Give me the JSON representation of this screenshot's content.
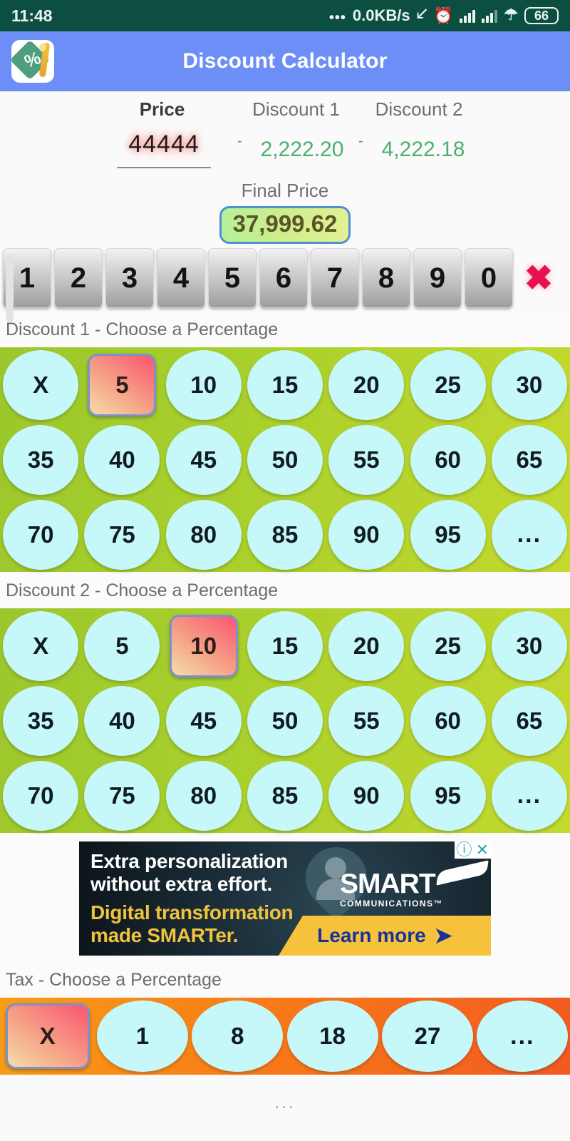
{
  "statusbar": {
    "time": "11:48",
    "dots": "•••",
    "net_speed": "0.0KB/s",
    "bluetooth_icon": "bluetooth-icon",
    "alarm_icon": "alarm-icon",
    "signal1_icon": "signal-bars-icon",
    "signal2_icon": "signal-bars-icon",
    "wifi_icon": "wifi-icon",
    "battery_level": "66",
    "bg_color": "#0c4f41"
  },
  "appbar": {
    "title": "Discount Calculator",
    "icon_name": "discount-tag-app-icon",
    "bg_color": "#6d8ef6"
  },
  "summary": {
    "price_label": "Price",
    "discount1_label": "Discount 1",
    "discount2_label": "Discount 2",
    "price_value": "44444",
    "minus1": "-",
    "minus2": "-",
    "discount1_value": "2,222.20",
    "discount2_value": "4,222.18",
    "final_label": "Final Price",
    "final_value": "37,999.62",
    "discount_color": "#4caf6d",
    "final_border_color": "#4d90d6"
  },
  "keypad": {
    "keys": [
      "1",
      "2",
      "3",
      "4",
      "5",
      "6",
      "7",
      "8",
      "9",
      "0"
    ],
    "delete_label": "✖",
    "delete_color": "#e8114e"
  },
  "discount1": {
    "label": "Discount 1 - Choose a Percentage",
    "options": [
      "X",
      "5",
      "10",
      "15",
      "20",
      "25",
      "30",
      "35",
      "40",
      "45",
      "50",
      "55",
      "60",
      "65",
      "70",
      "75",
      "80",
      "85",
      "90",
      "95",
      "..."
    ],
    "selected": "5",
    "bg_color": "#a8cf2c",
    "bubble_color": "#c6f7f9"
  },
  "discount2": {
    "label": "Discount 2 - Choose a Percentage",
    "options": [
      "X",
      "5",
      "10",
      "15",
      "20",
      "25",
      "30",
      "35",
      "40",
      "45",
      "50",
      "55",
      "60",
      "65",
      "70",
      "75",
      "80",
      "85",
      "90",
      "95",
      "..."
    ],
    "selected": "10",
    "bg_color": "#a8cf2c",
    "bubble_color": "#c6f7f9"
  },
  "ad": {
    "line1": "Extra personalization",
    "line2": "without extra effort.",
    "line3": "Digital transformation",
    "line4": "made SMARTer.",
    "brand": "SMART",
    "brand_sub": "COMMUNICATIONS™",
    "cta": "Learn more",
    "cta_chevron": "➤",
    "adchoices_info": "ⓘ",
    "adchoices_close": "✕"
  },
  "tax": {
    "label": "Tax - Choose a Percentage",
    "options": [
      "X",
      "1",
      "8",
      "18",
      "27",
      "..."
    ],
    "selected": "X",
    "bg_color": "#f97b17"
  },
  "footer": {
    "dots": "..."
  }
}
